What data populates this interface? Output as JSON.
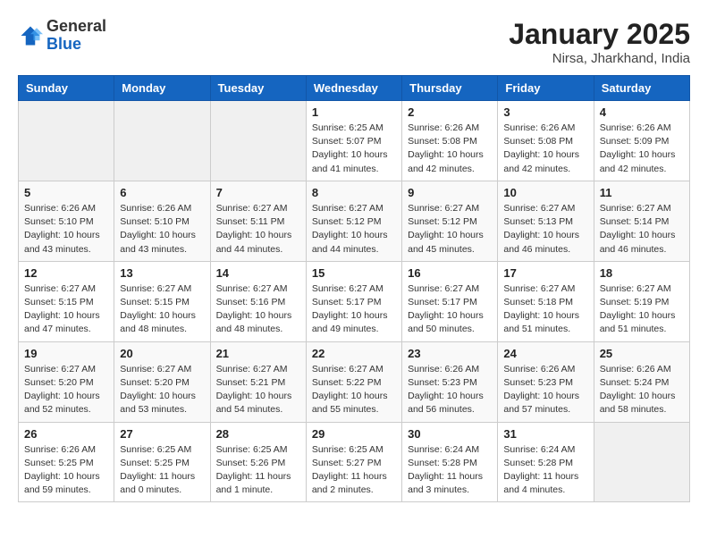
{
  "logo": {
    "general": "General",
    "blue": "Blue"
  },
  "header": {
    "month": "January 2025",
    "location": "Nirsa, Jharkhand, India"
  },
  "days_of_week": [
    "Sunday",
    "Monday",
    "Tuesday",
    "Wednesday",
    "Thursday",
    "Friday",
    "Saturday"
  ],
  "weeks": [
    [
      {
        "day": "",
        "info": ""
      },
      {
        "day": "",
        "info": ""
      },
      {
        "day": "",
        "info": ""
      },
      {
        "day": "1",
        "info": "Sunrise: 6:25 AM\nSunset: 5:07 PM\nDaylight: 10 hours\nand 41 minutes."
      },
      {
        "day": "2",
        "info": "Sunrise: 6:26 AM\nSunset: 5:08 PM\nDaylight: 10 hours\nand 42 minutes."
      },
      {
        "day": "3",
        "info": "Sunrise: 6:26 AM\nSunset: 5:08 PM\nDaylight: 10 hours\nand 42 minutes."
      },
      {
        "day": "4",
        "info": "Sunrise: 6:26 AM\nSunset: 5:09 PM\nDaylight: 10 hours\nand 42 minutes."
      }
    ],
    [
      {
        "day": "5",
        "info": "Sunrise: 6:26 AM\nSunset: 5:10 PM\nDaylight: 10 hours\nand 43 minutes."
      },
      {
        "day": "6",
        "info": "Sunrise: 6:26 AM\nSunset: 5:10 PM\nDaylight: 10 hours\nand 43 minutes."
      },
      {
        "day": "7",
        "info": "Sunrise: 6:27 AM\nSunset: 5:11 PM\nDaylight: 10 hours\nand 44 minutes."
      },
      {
        "day": "8",
        "info": "Sunrise: 6:27 AM\nSunset: 5:12 PM\nDaylight: 10 hours\nand 44 minutes."
      },
      {
        "day": "9",
        "info": "Sunrise: 6:27 AM\nSunset: 5:12 PM\nDaylight: 10 hours\nand 45 minutes."
      },
      {
        "day": "10",
        "info": "Sunrise: 6:27 AM\nSunset: 5:13 PM\nDaylight: 10 hours\nand 46 minutes."
      },
      {
        "day": "11",
        "info": "Sunrise: 6:27 AM\nSunset: 5:14 PM\nDaylight: 10 hours\nand 46 minutes."
      }
    ],
    [
      {
        "day": "12",
        "info": "Sunrise: 6:27 AM\nSunset: 5:15 PM\nDaylight: 10 hours\nand 47 minutes."
      },
      {
        "day": "13",
        "info": "Sunrise: 6:27 AM\nSunset: 5:15 PM\nDaylight: 10 hours\nand 48 minutes."
      },
      {
        "day": "14",
        "info": "Sunrise: 6:27 AM\nSunset: 5:16 PM\nDaylight: 10 hours\nand 48 minutes."
      },
      {
        "day": "15",
        "info": "Sunrise: 6:27 AM\nSunset: 5:17 PM\nDaylight: 10 hours\nand 49 minutes."
      },
      {
        "day": "16",
        "info": "Sunrise: 6:27 AM\nSunset: 5:17 PM\nDaylight: 10 hours\nand 50 minutes."
      },
      {
        "day": "17",
        "info": "Sunrise: 6:27 AM\nSunset: 5:18 PM\nDaylight: 10 hours\nand 51 minutes."
      },
      {
        "day": "18",
        "info": "Sunrise: 6:27 AM\nSunset: 5:19 PM\nDaylight: 10 hours\nand 51 minutes."
      }
    ],
    [
      {
        "day": "19",
        "info": "Sunrise: 6:27 AM\nSunset: 5:20 PM\nDaylight: 10 hours\nand 52 minutes."
      },
      {
        "day": "20",
        "info": "Sunrise: 6:27 AM\nSunset: 5:20 PM\nDaylight: 10 hours\nand 53 minutes."
      },
      {
        "day": "21",
        "info": "Sunrise: 6:27 AM\nSunset: 5:21 PM\nDaylight: 10 hours\nand 54 minutes."
      },
      {
        "day": "22",
        "info": "Sunrise: 6:27 AM\nSunset: 5:22 PM\nDaylight: 10 hours\nand 55 minutes."
      },
      {
        "day": "23",
        "info": "Sunrise: 6:26 AM\nSunset: 5:23 PM\nDaylight: 10 hours\nand 56 minutes."
      },
      {
        "day": "24",
        "info": "Sunrise: 6:26 AM\nSunset: 5:23 PM\nDaylight: 10 hours\nand 57 minutes."
      },
      {
        "day": "25",
        "info": "Sunrise: 6:26 AM\nSunset: 5:24 PM\nDaylight: 10 hours\nand 58 minutes."
      }
    ],
    [
      {
        "day": "26",
        "info": "Sunrise: 6:26 AM\nSunset: 5:25 PM\nDaylight: 10 hours\nand 59 minutes."
      },
      {
        "day": "27",
        "info": "Sunrise: 6:25 AM\nSunset: 5:25 PM\nDaylight: 11 hours\nand 0 minutes."
      },
      {
        "day": "28",
        "info": "Sunrise: 6:25 AM\nSunset: 5:26 PM\nDaylight: 11 hours\nand 1 minute."
      },
      {
        "day": "29",
        "info": "Sunrise: 6:25 AM\nSunset: 5:27 PM\nDaylight: 11 hours\nand 2 minutes."
      },
      {
        "day": "30",
        "info": "Sunrise: 6:24 AM\nSunset: 5:28 PM\nDaylight: 11 hours\nand 3 minutes."
      },
      {
        "day": "31",
        "info": "Sunrise: 6:24 AM\nSunset: 5:28 PM\nDaylight: 11 hours\nand 4 minutes."
      },
      {
        "day": "",
        "info": ""
      }
    ]
  ]
}
